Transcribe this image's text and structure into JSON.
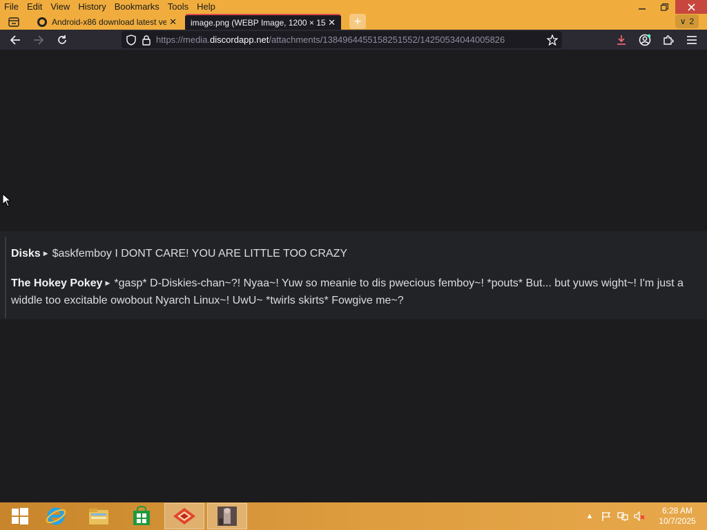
{
  "menu": {
    "items": [
      "File",
      "Edit",
      "View",
      "History",
      "Bookmarks",
      "Tools",
      "Help"
    ]
  },
  "tabs": [
    {
      "title": "Android-x86 download latest ve",
      "active": false
    },
    {
      "title": "image.png (WEBP Image, 1200 × 15",
      "active": true
    }
  ],
  "tabs_count": "2",
  "url": {
    "prefix": "https://media.",
    "domain": "discordapp.net",
    "suffix": "/attachments/1384964455158251552/14250534044005826"
  },
  "chat": {
    "messages": [
      {
        "author": "Disks",
        "text": "$askfemboy I DONT CARE! YOU ARE LITTLE TOO CRAZY"
      },
      {
        "author": "The Hokey Pokey",
        "text": "*gasp* D-Diskies-chan~?! Nyaa~! Yuw so meanie to dis pwecious femboy~! *pouts* But... but yuws wight~! I'm just a widdle too excitable owobout Nyarch Linux~! UwU~ *twirls skirts* Fowgive me~?"
      }
    ]
  },
  "taskbar": {
    "time": "6:28 AM",
    "date": "10/7/2025"
  },
  "colors": {
    "chrome_accent": "#f0ad3e",
    "toolbar": "#2b2a33",
    "page_bg": "#1c1b1e",
    "close_button": "#c7473f"
  }
}
